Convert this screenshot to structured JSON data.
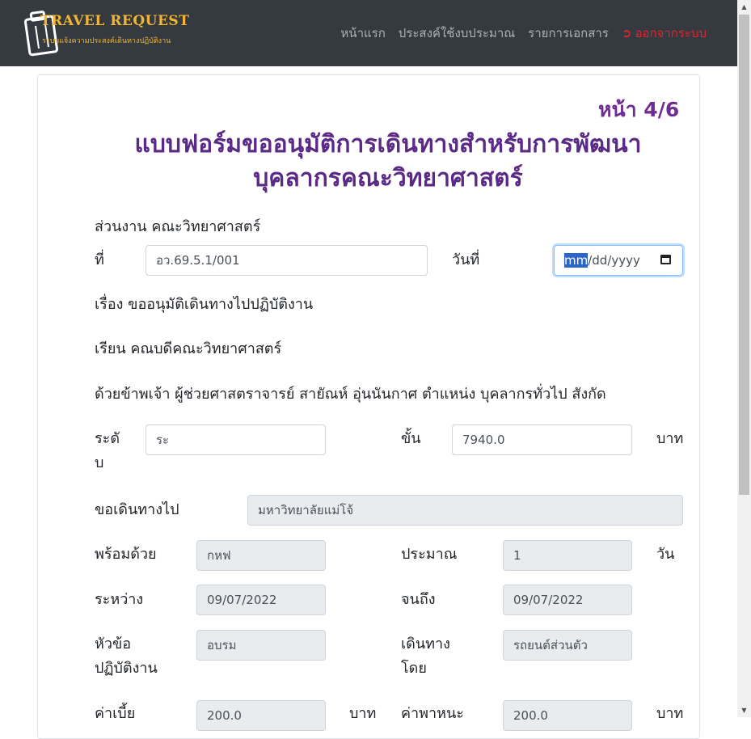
{
  "nav": {
    "logo_title": "TRAVEL REQUEST",
    "logo_subtitle": "ระบบแจ้งความประสงค์เดินทางปฏิบัติงาน",
    "links": [
      "หน้าแรก",
      "ประสงค์ใช้งบประมาณ",
      "รายการเอกสาร"
    ],
    "logout": "ออกจากระบบ"
  },
  "page": {
    "page_number": "หน้า 4/6",
    "title_line1": "แบบฟอร์มขออนุมัติการเดินทางสำหรับการพัฒนา",
    "title_line2": "บุคลากรคณะวิทยาศาสตร์"
  },
  "form": {
    "department": "ส่วนงาน คณะวิทยาศาสตร์",
    "no_label": "ที่",
    "no_value": "อว.69.5.1/001",
    "date_label": "วันที่",
    "date_placeholder_mm": "mm",
    "date_placeholder_rest": "/dd/yyyy",
    "subject": "เรื่อง ขออนุมัติเดินทางไปปฏิบัติงาน",
    "to": "เรียน คณบดีคณะวิทยาศาสตร์",
    "statement": "ด้วยข้าพเจ้า ผู้ช่วยศาสตราจารย์ สายัณห์ อุ่นนันกาศ ตำแหน่ง บุคลากรทั่วไป สังกัด",
    "level_label_1": "ระดั",
    "level_label_2": "บ",
    "level_value": "ระ",
    "step_label": "ขั้น",
    "step_value": "7940.0",
    "baht": "บาท",
    "travel_to_label": "ขอเดินทางไป",
    "travel_to_value": "มหาวิทยาลัยแม่โจ้",
    "with_label": "พร้อมด้วย",
    "with_value": "กหฟ",
    "approx_label": "ประมาณ",
    "approx_value": "1",
    "day_unit": "วัน",
    "between_label": "ระหว่าง",
    "between_value": "09/07/2022",
    "until_label": "จนถึง",
    "until_value": "09/07/2022",
    "topic_label_1": "หัวข้อ",
    "topic_label_2": "ปฏิบัติงาน",
    "topic_value": "อบรม",
    "travel_by_label_1": "เดินทาง",
    "travel_by_label_2": "โดย",
    "travel_by_value": "รถยนต์ส่วนตัว",
    "allowance_label": "ค่าเบี้ย",
    "allowance_value": "200.0",
    "vehicle_label": "ค่าพาหนะ",
    "vehicle_value": "200.0",
    "baht_2": "บาท",
    "baht_3": "บาท"
  }
}
